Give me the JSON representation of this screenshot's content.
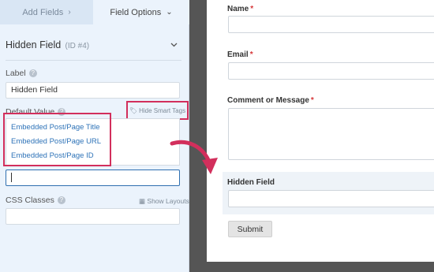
{
  "tabs": {
    "add_fields": "Add Fields",
    "add_fields_arrow": "›",
    "field_options": "Field Options",
    "field_options_arrow": "⌄"
  },
  "field_header": {
    "title": "Hidden Field",
    "id_text": "(ID #4)",
    "collapse_icon": "chevron-down-icon"
  },
  "label_section": {
    "label": "Label",
    "value": "Hidden Field"
  },
  "default_value": {
    "label": "Default Value",
    "smart_tags_link": "Hide Smart Tags",
    "smart_tags": [
      "Embedded Post/Page Title",
      "Embedded Post/Page URL",
      "Embedded Post/Page ID"
    ],
    "input_value": ""
  },
  "css_classes": {
    "label": "CSS Classes",
    "show_layouts": "Show Layouts",
    "value": ""
  },
  "preview": {
    "fields": [
      {
        "label": "Name",
        "required": "*"
      },
      {
        "label": "Email",
        "required": "*"
      },
      {
        "label": "Comment or Message",
        "required": "*"
      },
      {
        "label": "Hidden Field",
        "required": ""
      }
    ],
    "submit_label": "Submit"
  },
  "colors": {
    "highlight": "#d22f5c",
    "link": "#2e73b8",
    "panel_bg": "#ebf3fc",
    "canvas_bg": "#555555"
  }
}
